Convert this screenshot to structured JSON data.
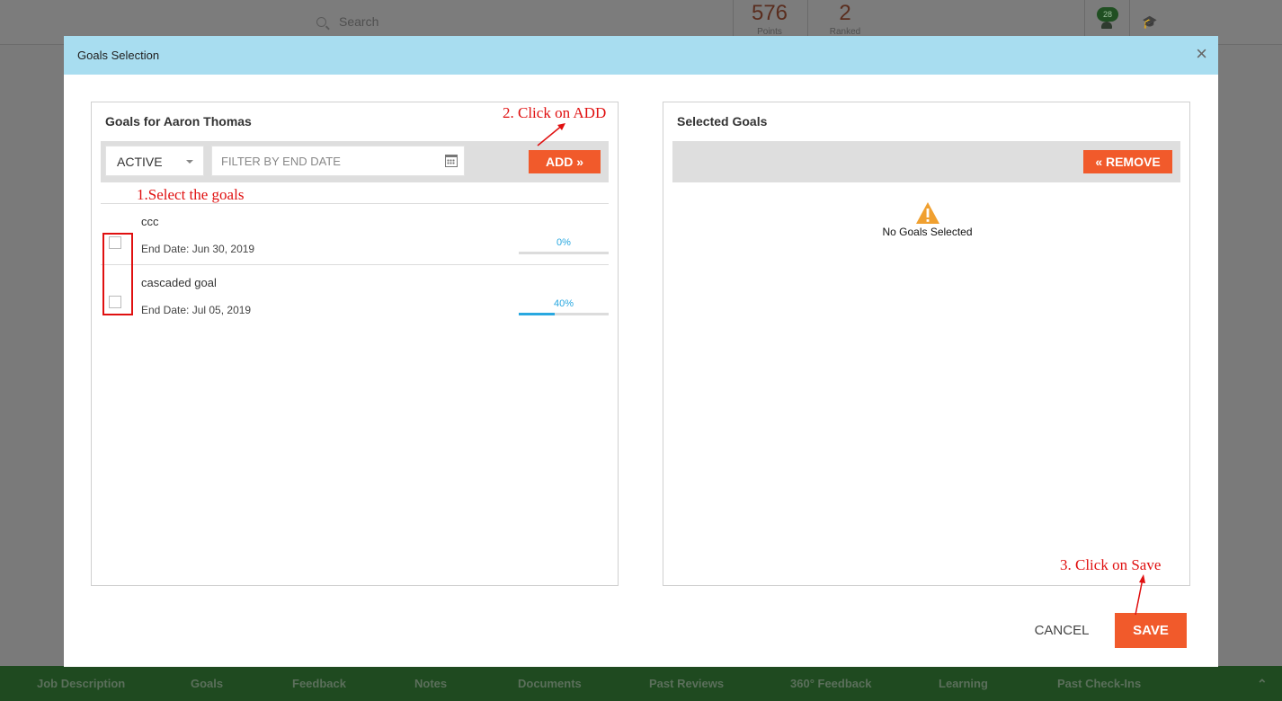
{
  "background": {
    "search_placeholder": "Search",
    "points_value": "576",
    "points_label": "Points",
    "ranked_value": "2",
    "ranked_label": "Ranked",
    "notification_count": "28",
    "bottom_nav": [
      "Job Description",
      "Goals",
      "Feedback",
      "Notes",
      "Documents",
      "Past Reviews",
      "360° Feedback",
      "Learning",
      "Past Check-Ins"
    ]
  },
  "modal": {
    "title": "Goals Selection",
    "close_glyph": "×",
    "left_panel": {
      "title": "Goals for Aaron Thomas",
      "status_filter": "ACTIVE",
      "date_filter_placeholder": "FILTER BY END DATE",
      "add_label": "ADD »",
      "goals": [
        {
          "name": "ccc",
          "end_date": "End Date: Jun 30, 2019",
          "progress_label": "0%",
          "progress": 0.0
        },
        {
          "name": "cascaded goal",
          "end_date": "End Date: Jul 05, 2019",
          "progress_label": "40%",
          "progress": 0.4
        }
      ]
    },
    "right_panel": {
      "title": "Selected Goals",
      "remove_label": "« REMOVE",
      "empty_text": "No Goals Selected"
    },
    "footer": {
      "cancel_label": "CANCEL",
      "save_label": "SAVE"
    }
  },
  "annotations": {
    "step1": "1.Select the goals",
    "step2": "2. Click on ADD",
    "step3": "3. Click on Save"
  },
  "colors": {
    "header_bg": "#a8ddf0",
    "accent": "#f15a2b",
    "progress": "#29a8e0",
    "annotation": "#e01010",
    "warning": "#f0a030"
  }
}
